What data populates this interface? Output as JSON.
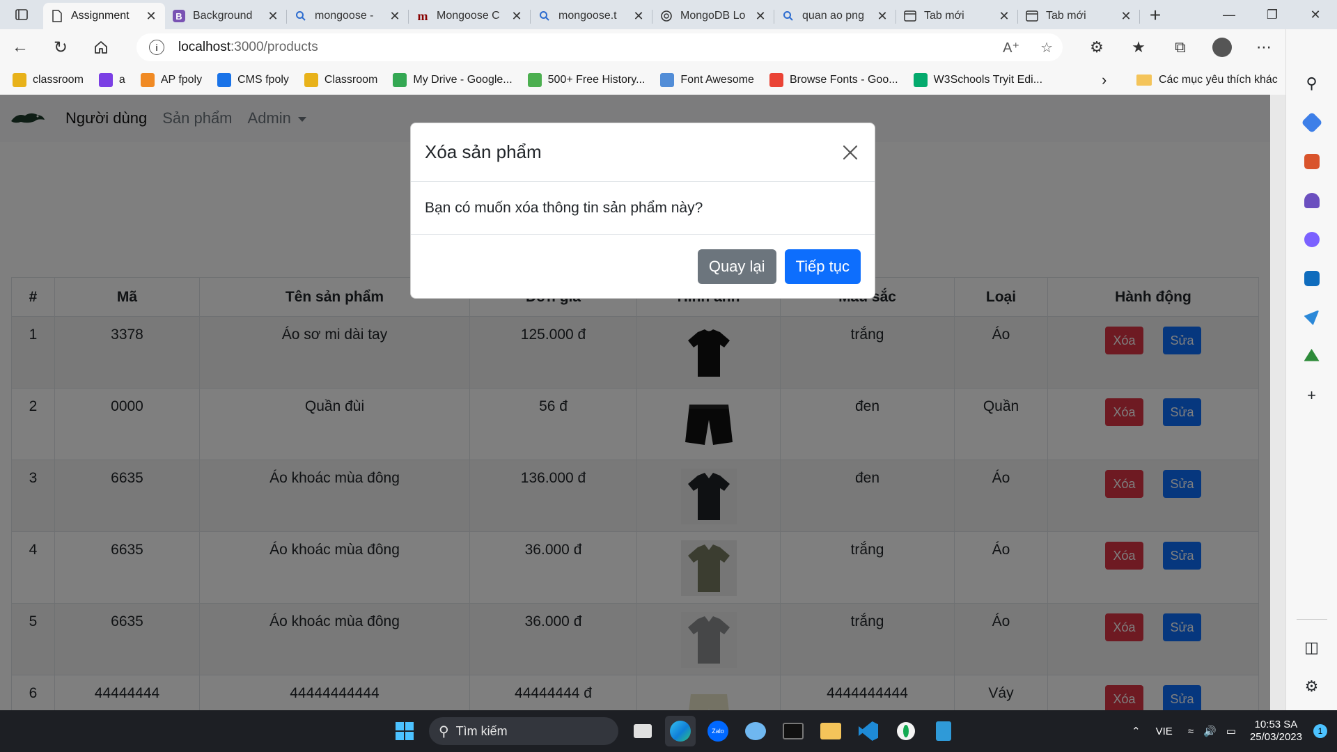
{
  "browser": {
    "tabs": [
      {
        "title": "Assignment",
        "favicon": "page-icon",
        "active": true
      },
      {
        "title": "Background",
        "favicon": "bootstrap-icon",
        "active": false
      },
      {
        "title": "mongoose - ",
        "favicon": "search-icon",
        "active": false
      },
      {
        "title": "Mongoose C",
        "favicon": "mongoose-icon",
        "active": false
      },
      {
        "title": "mongoose.t",
        "favicon": "search-icon",
        "active": false
      },
      {
        "title": "MongoDB Lo",
        "favicon": "chatgpt-icon",
        "active": false
      },
      {
        "title": "quan ao png",
        "favicon": "search-icon",
        "active": false
      },
      {
        "title": "Tab mới",
        "favicon": "newtab-icon",
        "active": false
      },
      {
        "title": "Tab mới",
        "favicon": "newtab-icon",
        "active": false
      }
    ],
    "address": {
      "host": "localhost",
      "path": ":3000/products"
    },
    "favorites": [
      {
        "label": "classroom",
        "icon_color": "#e8b21a"
      },
      {
        "label": "a",
        "icon_color": "#7b3fe4"
      },
      {
        "label": "AP fpoly",
        "icon_color": "#f08a24"
      },
      {
        "label": "CMS fpoly",
        "icon_color": "#1a73e8"
      },
      {
        "label": "Classroom",
        "icon_color": "#e8b21a"
      },
      {
        "label": "My Drive - Google...",
        "icon_color": "#34a853"
      },
      {
        "label": "500+ Free History...",
        "icon_color": "#4caf50"
      },
      {
        "label": "Font Awesome",
        "icon_color": "#528dd7"
      },
      {
        "label": "Browse Fonts - Goo...",
        "icon_color": "#ea4335"
      },
      {
        "label": "W3Schools Tryit Edi...",
        "icon_color": "#04aa6d"
      }
    ],
    "favorites_other": "Các mục yêu thích khác"
  },
  "app": {
    "nav": {
      "users": "Người dùng",
      "products": "Sản phẩm",
      "admin": "Admin"
    },
    "table": {
      "headers": [
        "#",
        "Mã",
        "Tên sản phẩm",
        "Đơn giá",
        "Hình ảnh",
        "Màu sắc",
        "Loại",
        "Hành động"
      ],
      "rows": [
        {
          "no": "1",
          "code": "3378",
          "name": "Áo sơ mi dài tay",
          "price": "125.000 đ",
          "image": "black-tshirt",
          "color": "trắng",
          "type": "Áo"
        },
        {
          "no": "2",
          "code": "0000",
          "name": "Quần đùi",
          "price": "56 đ",
          "image": "black-shorts",
          "color": "đen",
          "type": "Quần"
        },
        {
          "no": "3",
          "code": "6635",
          "name": "Áo khoác mùa đông",
          "price": "136.000 đ",
          "image": "dark-polo",
          "color": "đen",
          "type": "Áo"
        },
        {
          "no": "4",
          "code": "6635",
          "name": "Áo khoác mùa đông",
          "price": "36.000 đ",
          "image": "olive-polo",
          "color": "trắng",
          "type": "Áo"
        },
        {
          "no": "5",
          "code": "6635",
          "name": "Áo khoác mùa đông",
          "price": "36.000 đ",
          "image": "grey-polo",
          "color": "trắng",
          "type": "Áo"
        },
        {
          "no": "6",
          "code": "44444444",
          "name": "44444444444",
          "price": "44444444 đ",
          "image": "beige-shorts",
          "color": "4444444444",
          "type": "Váy"
        }
      ],
      "delete_label": "Xóa",
      "edit_label": "Sửa"
    },
    "modal": {
      "title": "Xóa sản phẩm",
      "body": "Bạn có muốn xóa thông tin sản phẩm này?",
      "back_label": "Quay lại",
      "continue_label": "Tiếp tục"
    }
  },
  "taskbar": {
    "search_placeholder": "Tìm kiếm",
    "language": "VIE",
    "time": "10:53 SA",
    "date": "25/03/2023",
    "notifications": "1"
  },
  "colors": {
    "danger": "#dc3545",
    "primary": "#0d6efd",
    "secondary": "#6c757d",
    "backdrop": "rgba(0,0,0,0.5)"
  }
}
